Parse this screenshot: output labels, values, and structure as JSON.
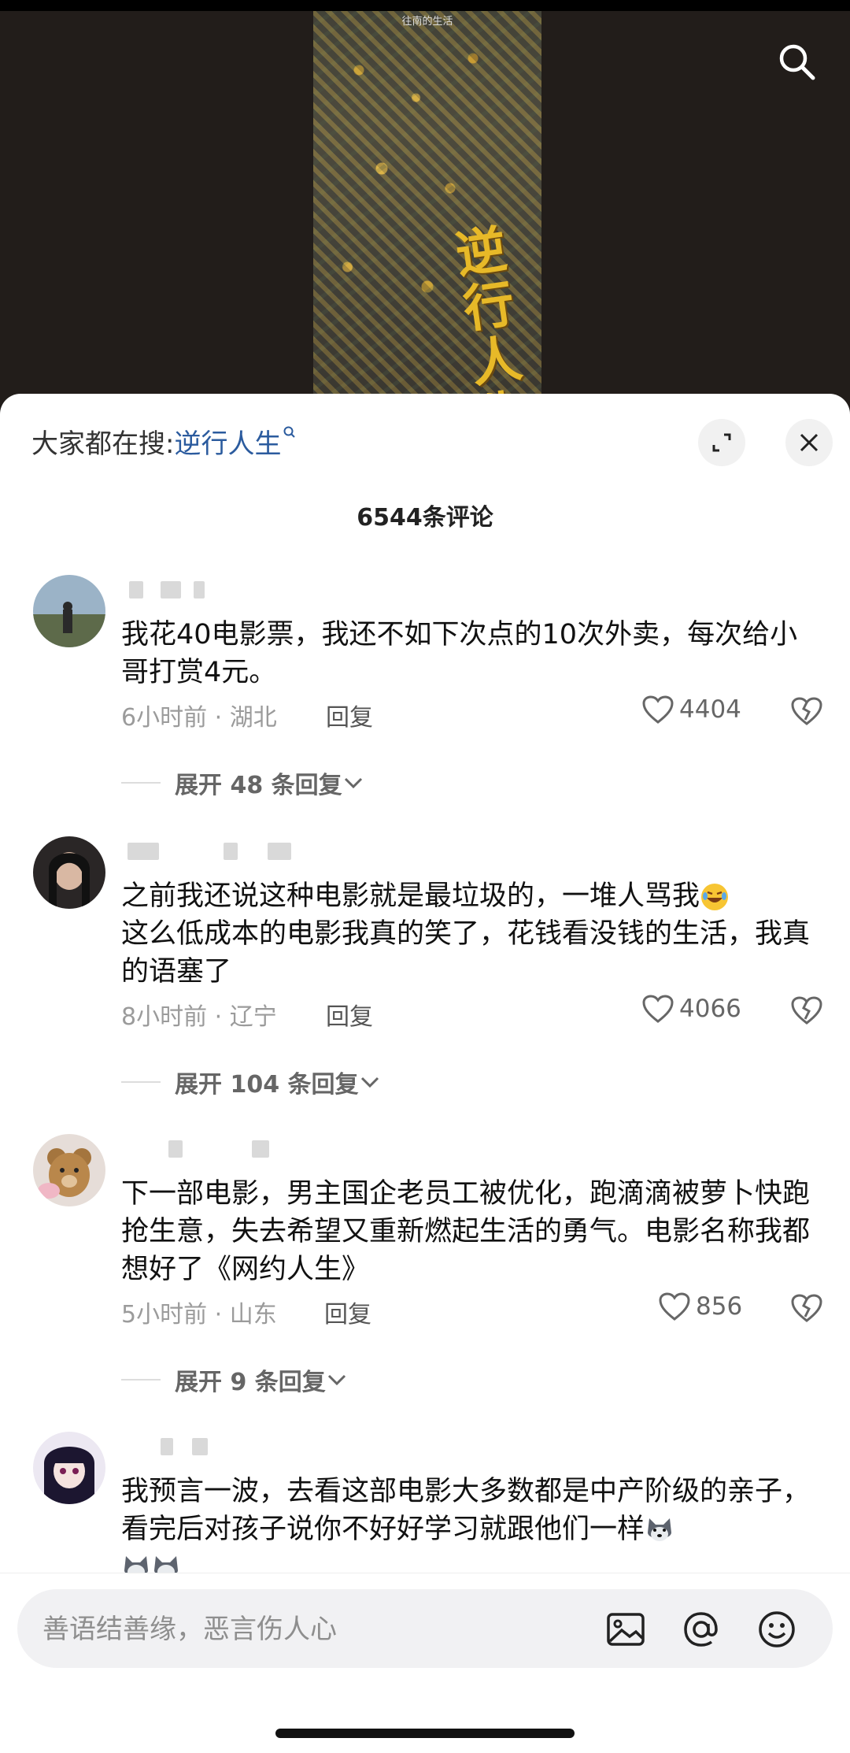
{
  "video": {
    "poster_title": "逆行人生",
    "poster_top_text": "往南的生活"
  },
  "sheet": {
    "search_prefix": "大家都在搜:",
    "search_keyword": "逆行人生",
    "comment_count": "6544条评论"
  },
  "comments": [
    {
      "text": "我花40电影票，我还不如下次点的10次外卖，每次给小哥打赏4元。",
      "time_location": "6小时前 · 湖北",
      "reply_label": "回复",
      "likes": "4404",
      "expand_label": "展开 48 条回复"
    },
    {
      "text": "之前我还说这种电影就是最垃圾的，一堆人骂我",
      "text_after_emoji": "这么低成本的电影我真的笑了，花钱看没钱的生活，我真的语塞了",
      "emoji": "rolling-laughing-emoji",
      "time_location": "8小时前 · 辽宁",
      "reply_label": "回复",
      "likes": "4066",
      "expand_label": "展开 104 条回复"
    },
    {
      "text": "下一部电影，男主国企老员工被优化，跑滴滴被萝卜快跑抢生意，失去希望又重新燃起生活的勇气。电影名称我都想好了《网约人生》",
      "time_location": "5小时前 · 山东",
      "reply_label": "回复",
      "likes": "856",
      "expand_label": "展开 9 条回复"
    },
    {
      "text": "我预言一波，去看这部电影大多数都是中产阶级的亲子，看完后对孩子说你不好好学习就跟他们一样",
      "emoji": "husky-dog-emoji"
    }
  ],
  "input": {
    "placeholder": "善语结善缘，恶言伤人心"
  },
  "icons": [
    "search-icon",
    "expand-icon",
    "close-icon",
    "heart-icon",
    "dislike-heart-icon",
    "chevron-down-icon",
    "image-icon",
    "at-icon",
    "smile-icon"
  ],
  "colors": {
    "keyword": "#2b5b9e",
    "poster_title": "#e7b928",
    "sheet_bg": "#ffffff",
    "video_bg": "#221d1a"
  }
}
